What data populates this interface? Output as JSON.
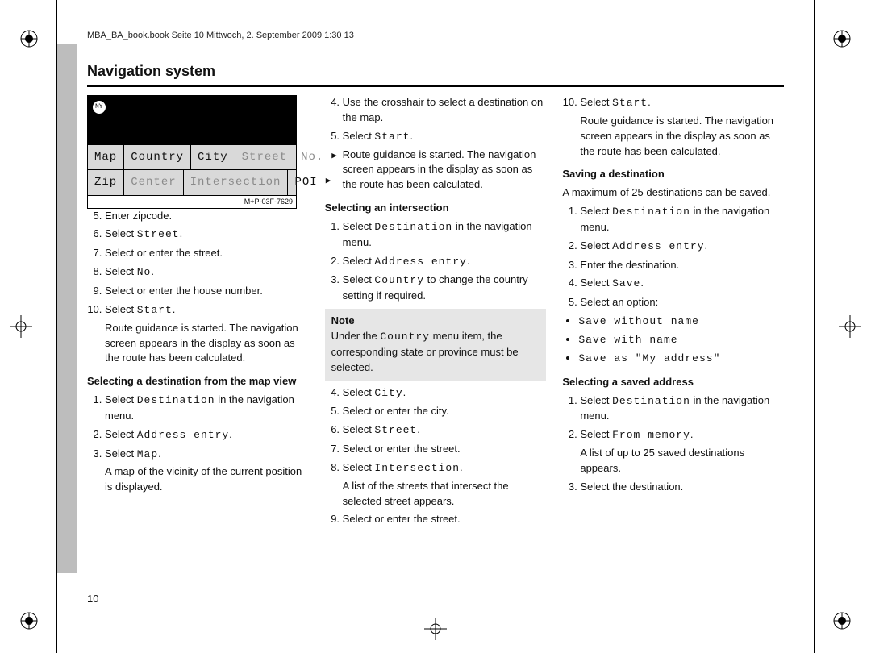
{
  "header_info": "MBA_BA_book.book  Seite 10  Mittwoch, 2. September 2009  1:30 13",
  "page_title": "Navigation system",
  "page_number": "10",
  "figure": {
    "ny_badge": "NY",
    "row1": {
      "c1": "Map",
      "c2": "Country",
      "c3": "City",
      "c4": "Street",
      "c5": "No."
    },
    "row2": {
      "c1": "Zip",
      "c2": "Center",
      "c3": "Intersection",
      "c4": "POI"
    },
    "caption": "M+P-03F-7629"
  },
  "col1": {
    "s5": "Enter zipcode.",
    "s6a": "Select ",
    "s6b": "Street",
    "s6c": ".",
    "s7": "Select or enter the street.",
    "s8a": "Select ",
    "s8b": "No",
    "s8c": ".",
    "s9": "Select or enter the house number.",
    "s10a": "Select ",
    "s10b": "Start",
    "s10c": ".",
    "s10cont": "Route guidance is started. The navigation screen appears in the display as soon as the route has been calculated.",
    "sub1": "Selecting a destination from the map view",
    "m1a": "Select ",
    "m1b": "Destination",
    "m1c": " in the navigation menu.",
    "m2a": "Select ",
    "m2b": "Address entry",
    "m2c": ".",
    "m3a": "Select ",
    "m3b": "Map",
    "m3c": ".",
    "m3cont": "A map of the vicinity of the current position is displayed."
  },
  "col2": {
    "c4": "Use the crosshair to select a destination on the map.",
    "c5a": "Select ",
    "c5b": "Start",
    "c5c": ".",
    "c5cont": "Route guidance is started. The navigation screen appears in the display as soon as the route has been calculated.",
    "sub1": "Selecting an intersection",
    "i1a": "Select ",
    "i1b": "Destination",
    "i1c": " in the navigation menu.",
    "i2a": "Select ",
    "i2b": "Address entry",
    "i2c": ".",
    "i3a": "Select ",
    "i3b": "Country",
    "i3c": " to change the country setting if required.",
    "note_label": "Note",
    "note_a": "Under the ",
    "note_b": "Country",
    "note_c": " menu item, the corresponding state or province must be selected.",
    "i4a": "Select ",
    "i4b": "City",
    "i4c": ".",
    "i5": "Select or enter the city.",
    "i6a": "Select ",
    "i6b": "Street",
    "i6c": ".",
    "i7": "Select or enter the street.",
    "i8a": "Select ",
    "i8b": "Intersection",
    "i8c": ".",
    "i8cont": "A list of the streets that intersect the selected street appears.",
    "i9": "Select or enter the street."
  },
  "col3": {
    "t10a": "Select ",
    "t10b": "Start",
    "t10c": ".",
    "t10cont": "Route guidance is started. The navigation screen appears in the display as soon as the route has been calculated.",
    "sub1": "Saving a destination",
    "save_intro": "A maximum of 25 destinations can be saved.",
    "sv1a": "Select ",
    "sv1b": "Destination",
    "sv1c": " in the navigation menu.",
    "sv2a": "Select ",
    "sv2b": "Address entry",
    "sv2c": ".",
    "sv3": "Enter the destination.",
    "sv4a": "Select ",
    "sv4b": "Save",
    "sv4c": ".",
    "sv5": "Select an option:",
    "opt1": "Save without name",
    "opt2": "Save with name",
    "opt3": "Save as \"My address\"",
    "sub2": "Selecting a saved address",
    "sa1a": "Select ",
    "sa1b": "Destination",
    "sa1c": " in the navigation menu.",
    "sa2a": "Select ",
    "sa2b": "From memory",
    "sa2c": ".",
    "sa2cont": "A list of up to 25 saved destinations appears.",
    "sa3": "Select the destination."
  }
}
